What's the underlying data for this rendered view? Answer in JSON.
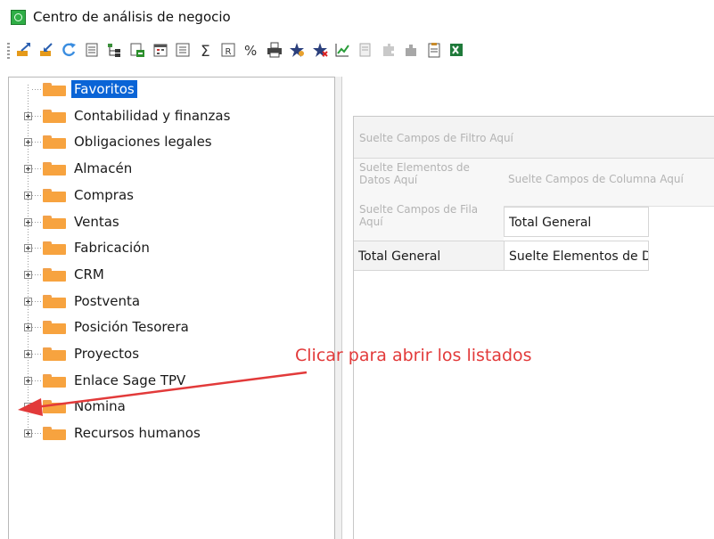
{
  "window": {
    "title": "Centro de análisis de negocio"
  },
  "toolbar": {
    "buttons": [
      {
        "icon": "export-icon"
      },
      {
        "icon": "import-icon"
      },
      {
        "icon": "refresh-icon"
      },
      {
        "icon": "list-icon"
      },
      {
        "icon": "tree-icon"
      },
      {
        "icon": "table-export-icon"
      },
      {
        "icon": "calendar-icon"
      },
      {
        "icon": "form-icon"
      },
      {
        "icon": "sum-icon"
      },
      {
        "icon": "report-icon"
      },
      {
        "icon": "percent-icon"
      },
      {
        "icon": "print-icon"
      },
      {
        "icon": "favorite-add-icon"
      },
      {
        "icon": "favorite-remove-icon"
      },
      {
        "icon": "chart-icon"
      },
      {
        "icon": "document-disabled-icon"
      },
      {
        "icon": "puzzle-disabled-icon"
      },
      {
        "icon": "puzzle-icon"
      },
      {
        "icon": "clipboard-icon"
      },
      {
        "icon": "excel-icon"
      }
    ]
  },
  "tree": {
    "items": [
      {
        "label": "Favoritos",
        "selected": true,
        "expandable": false
      },
      {
        "label": "Contabilidad y finanzas",
        "expandable": true
      },
      {
        "label": "Obligaciones legales",
        "expandable": true
      },
      {
        "label": "Almacén",
        "expandable": true
      },
      {
        "label": "Compras",
        "expandable": true
      },
      {
        "label": "Ventas",
        "expandable": true
      },
      {
        "label": "Fabricación",
        "expandable": true
      },
      {
        "label": "CRM",
        "expandable": true
      },
      {
        "label": "Postventa",
        "expandable": true
      },
      {
        "label": "Posición Tesorera",
        "expandable": true
      },
      {
        "label": "Proyectos",
        "expandable": true
      },
      {
        "label": "Enlace Sage TPV",
        "expandable": true
      },
      {
        "label": "Nómina",
        "expandable": true
      },
      {
        "label": "Recursos humanos",
        "expandable": true
      }
    ]
  },
  "pivot": {
    "filter_hint": "Suelte Campos de Filtro Aquí",
    "data_hint": "Suelte Elementos de Datos Aquí",
    "column_hint": "Suelte Campos de Columna Aquí",
    "row_hint": "Suelte Campos de Fila Aquí",
    "column_total": "Total General",
    "row_total": "Total General",
    "data_cell": "Suelte Elementos de Datos Aquí"
  },
  "annotation": {
    "text": "Clicar para abrir los listados",
    "color": "#e23a3a"
  },
  "colors": {
    "selection": "#0a64d6",
    "folder": "#f7a33f",
    "accent": "#2fae46"
  }
}
